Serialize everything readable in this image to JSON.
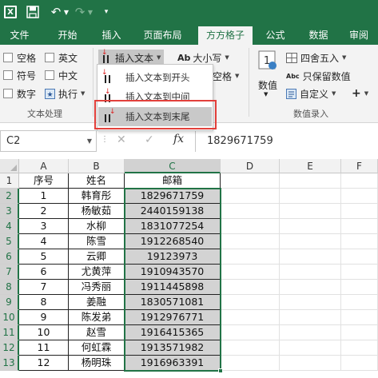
{
  "titlebar": {
    "logo_letter": "X",
    "icons": [
      "excel-logo-icon",
      "save-icon",
      "undo-icon",
      "redo-icon",
      "quick-access-more-icon"
    ]
  },
  "tabs": [
    "文件",
    "开始",
    "插入",
    "页面布局",
    "方方格子",
    "公式",
    "数据",
    "审阅"
  ],
  "active_tab": "方方格子",
  "ribbon": {
    "text_group": {
      "checkboxes": [
        "空格",
        "英文",
        "符号",
        "中文",
        "数字"
      ],
      "execute_label": "执行",
      "label": "文本处理"
    },
    "insert_text_label": "插入文本",
    "case_label": "大小写",
    "space_partial": "空格",
    "numeric_group": {
      "value_label": "数值",
      "round_label": "四舍五入",
      "keep_value_label": "只保留数值",
      "custom_label": "自定义",
      "plus_label": "+",
      "label": "数值录入"
    },
    "dropdown": {
      "items": [
        "插入文本到开头",
        "插入文本到中间",
        "插入文本到末尾"
      ],
      "highlighted": 2
    }
  },
  "formula_bar": {
    "name_box": "C2",
    "cancel": "✕",
    "enter": "✓",
    "fx": "fx",
    "value": "1829671759"
  },
  "grid": {
    "columns": [
      "A",
      "B",
      "C",
      "D",
      "E",
      "F"
    ],
    "rows": [
      [
        "序号",
        "姓名",
        "邮箱"
      ],
      [
        "1",
        "韩育彤",
        "1829671759"
      ],
      [
        "2",
        "杨敏茹",
        "2440159138"
      ],
      [
        "3",
        "水柳",
        "1831077254"
      ],
      [
        "4",
        "陈雪",
        "1912268540"
      ],
      [
        "5",
        "云卿",
        "19123973"
      ],
      [
        "6",
        "尤黄萍",
        "1910943570"
      ],
      [
        "7",
        "冯秀丽",
        "1911445898"
      ],
      [
        "8",
        "姜融",
        "1830571081"
      ],
      [
        "9",
        "陈发弟",
        "1912976771"
      ],
      [
        "10",
        "赵雪",
        "1916415365"
      ],
      [
        "11",
        "何虹霖",
        "1913571982"
      ],
      [
        "12",
        "杨明珠",
        "1916963391"
      ]
    ],
    "row_numbers": [
      "1",
      "2",
      "3",
      "4",
      "5",
      "6",
      "7",
      "8",
      "9",
      "10",
      "11",
      "12",
      "13"
    ],
    "selected_column": "C",
    "selection_range": "C2:C13"
  },
  "colors": {
    "accent": "#217346",
    "selection_fill": "#d3d3d3",
    "highlight_frame": "#e2403b"
  }
}
